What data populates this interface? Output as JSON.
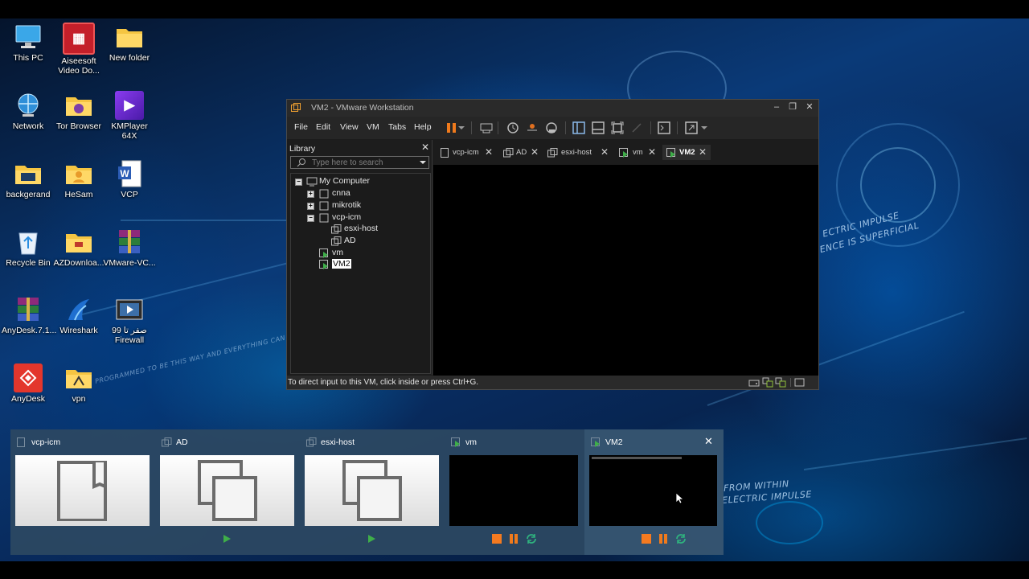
{
  "desktop": {
    "icons": [
      {
        "label": "This PC",
        "icon": "monitor-icon"
      },
      {
        "label": "Aiseesoft Video Do...",
        "icon": "aiseesoft-icon"
      },
      {
        "label": "New folder",
        "icon": "folder-icon"
      },
      {
        "label": "Network",
        "icon": "network-icon"
      },
      {
        "label": "Tor Browser",
        "icon": "tor-folder-icon"
      },
      {
        "label": "KMPlayer 64X",
        "icon": "kmplayer-icon"
      },
      {
        "label": "backgerand",
        "icon": "folder-icon"
      },
      {
        "label": "HeSam",
        "icon": "user-folder-icon"
      },
      {
        "label": "VCP",
        "icon": "word-doc-icon"
      },
      {
        "label": "Recycle Bin",
        "icon": "recycle-bin-icon"
      },
      {
        "label": "AZDownloa...",
        "icon": "folder-icon"
      },
      {
        "label": "VMware-VC...",
        "icon": "winrar-icon"
      },
      {
        "label": "AnyDesk.7.1...",
        "icon": "winrar-icon"
      },
      {
        "label": "Wireshark",
        "icon": "wireshark-icon"
      },
      {
        "label": "صفر تا 99 Firewall",
        "icon": "video-file-icon"
      },
      {
        "label": "AnyDesk",
        "icon": "anydesk-icon"
      },
      {
        "label": "vpn",
        "icon": "folder-icon"
      }
    ],
    "wallpaper_text": [
      "ECTRIC IMPULSE",
      "ENCE IS SUPERFICIAL",
      "FROM WITHIN",
      "ELECTRIC IMPULSE",
      "AMMED TO BE THIS WAY AND EVERYTHING CAN BE",
      "PROGRAMMED TO BE THIS WAY AND EVERYTHING CAN BE"
    ]
  },
  "window": {
    "title": "VM2 - VMware Workstation",
    "menu": [
      "File",
      "Edit",
      "View",
      "VM",
      "Tabs",
      "Help"
    ],
    "library_title": "Library",
    "search_placeholder": "Type here to search",
    "tree": {
      "root": "My Computer",
      "items": [
        "cnna",
        "mikrotik",
        "vcp-icm",
        "esxi-host",
        "AD",
        "vm",
        "VM2"
      ]
    },
    "tabs": [
      "vcp-icm",
      "AD",
      "esxi-host",
      "vm",
      "VM2"
    ],
    "status": "To direct input to this VM, click inside or press Ctrl+G."
  },
  "preview": {
    "cards": [
      {
        "title": "vcp-icm"
      },
      {
        "title": "AD"
      },
      {
        "title": "esxi-host"
      },
      {
        "title": "vm"
      },
      {
        "title": "VM2"
      }
    ]
  },
  "colors": {
    "accent_orange": "#f47a20",
    "pause_orange": "#f07a1c",
    "play_green": "#3fae49",
    "refresh_green": "#2fb37f",
    "window_bg": "#1c1c1c"
  }
}
